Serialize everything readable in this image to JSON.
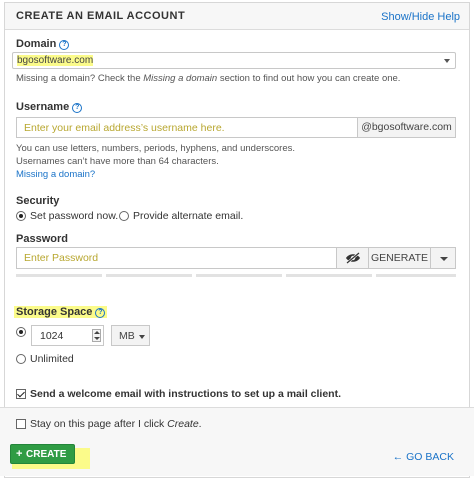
{
  "header": {
    "title": "CREATE AN EMAIL ACCOUNT",
    "help_link": "Show/Hide Help"
  },
  "domain": {
    "label": "Domain",
    "selected": "bgosoftware.com",
    "help_before": "Missing a domain? Check the ",
    "help_em": "Missing a domain",
    "help_after": " section to find out how you can create one."
  },
  "username": {
    "label": "Username",
    "placeholder": "Enter your email address’s username here.",
    "suffix": "@bgosoftware.com",
    "help_line1": "You can use letters, numbers, periods, hyphens, and underscores.",
    "help_line2": "Usernames can’t have more than 64 characters.",
    "missing_link": "Missing a domain?"
  },
  "security": {
    "label": "Security",
    "option_set": "Set password now.",
    "option_alternate": "Provide alternate email.",
    "selected": "Set password now."
  },
  "password": {
    "label": "Password",
    "placeholder": "Enter Password",
    "generate_label": "GENERATE"
  },
  "storage": {
    "label": "Storage Space",
    "value": "1024",
    "unit": "MB",
    "unlimited_label": "Unlimited",
    "selected": "1024"
  },
  "welcome_email": {
    "label": "Send a welcome email with instructions to set up a mail client.",
    "checked": true
  },
  "stay_on_page": {
    "label_before": "Stay on this page after I click ",
    "label_em": "Create",
    "label_after": ".",
    "checked": false
  },
  "actions": {
    "create_label": "CREATE",
    "go_back_label": "GO BACK"
  },
  "colors": {
    "link": "#1a73c8",
    "primary_button": "#2f9c44",
    "highlight": "#fbfb8a"
  },
  "icons": {
    "info": "info-circle-icon",
    "eye_slash": "eye-slash-icon",
    "plus": "plus-icon",
    "back": "arrow-left-icon"
  }
}
